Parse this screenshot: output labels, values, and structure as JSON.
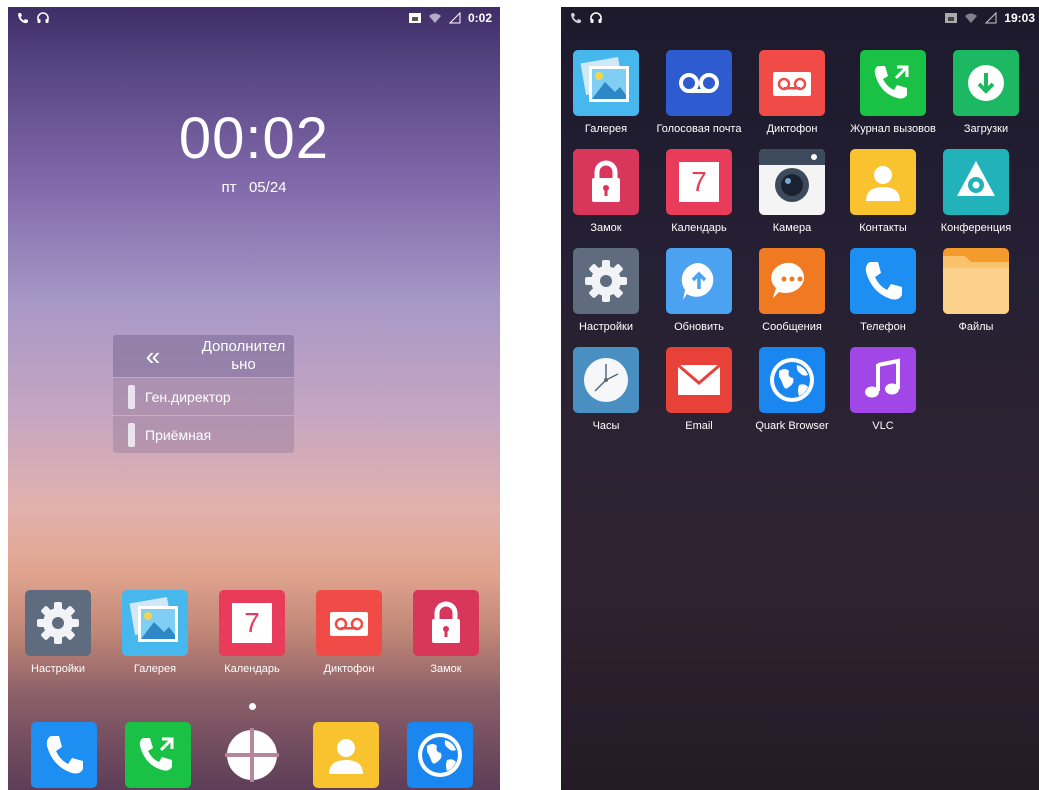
{
  "left_screen": {
    "status_bar": {
      "time": "0:02",
      "icons_left": [
        "phone-icon",
        "headset-icon"
      ],
      "icons_right": [
        "sim-icon",
        "wifi-icon",
        "signal-icon"
      ]
    },
    "lock_clock": {
      "time": "00:02",
      "date": "пт   05/24"
    },
    "contact_menu": {
      "header_label": "Дополнительно",
      "header_line1": "Дополнител",
      "header_line2": "ьно",
      "items": [
        {
          "label": "Ген.директор"
        },
        {
          "label": "Приёмная"
        }
      ]
    },
    "home_apps": [
      {
        "label": "Настройки",
        "icon": "settings-icon"
      },
      {
        "label": "Галерея",
        "icon": "gallery-icon"
      },
      {
        "label": "Календарь",
        "icon": "calendar-icon",
        "number": "7"
      },
      {
        "label": "Диктофон",
        "icon": "recorder-icon"
      },
      {
        "label": "Замок",
        "icon": "lock-icon"
      }
    ],
    "dock": [
      {
        "icon": "phone-icon"
      },
      {
        "icon": "call-log-icon"
      },
      {
        "icon": "app-drawer-icon"
      },
      {
        "icon": "contacts-icon"
      },
      {
        "icon": "browser-icon"
      }
    ]
  },
  "right_screen": {
    "status_bar": {
      "time": "19:03",
      "icons_left": [
        "phone-icon",
        "headset-icon"
      ],
      "icons_right": [
        "sim-icon",
        "wifi-icon",
        "signal-icon"
      ]
    },
    "apps": [
      {
        "label": "Галерея",
        "icon": "gallery-icon"
      },
      {
        "label": "Голосовая почта",
        "icon": "voicemail-icon"
      },
      {
        "label": "Диктофон",
        "icon": "recorder-icon"
      },
      {
        "label": "Журнал вызовов",
        "icon": "call-log-icon"
      },
      {
        "label": "Загрузки",
        "icon": "download-icon"
      },
      {
        "label": "Замок",
        "icon": "lock-icon"
      },
      {
        "label": "Календарь",
        "icon": "calendar-icon",
        "number": "7"
      },
      {
        "label": "Камера",
        "icon": "camera-icon"
      },
      {
        "label": "Контакты",
        "icon": "contacts-icon"
      },
      {
        "label": "Конференция",
        "icon": "conference-icon"
      },
      {
        "label": "Настройки",
        "icon": "settings-icon"
      },
      {
        "label": "Обновить",
        "icon": "update-icon"
      },
      {
        "label": "Сообщения",
        "icon": "messages-icon"
      },
      {
        "label": "Телефон",
        "icon": "phone-icon"
      },
      {
        "label": "Файлы",
        "icon": "files-icon"
      },
      {
        "label": "Часы",
        "icon": "clock-icon"
      },
      {
        "label": "Email",
        "icon": "email-icon"
      },
      {
        "label": "Quark Browser",
        "icon": "browser-icon"
      },
      {
        "label": "VLC",
        "icon": "vlc-icon"
      }
    ]
  },
  "colors": {
    "settings": "#5f6b7f",
    "gallery": "#46b8ee",
    "calendar": "#e83c5a",
    "recorder": "#f04b47",
    "lock": "#d8365a",
    "phone": "#1e8ff2",
    "call_log": "#19c145",
    "contacts": "#f9c22f",
    "browser": "#1a86f0",
    "voicemail": "#2f5bd0",
    "download": "#1db862",
    "camera": "#f4f4f4",
    "conference": "#21b3b9",
    "update": "#4aa2f0",
    "messages": "#f07a22",
    "files": "#f59a2c",
    "clock": "#4a8fc2",
    "email": "#e8413a",
    "vlc": "#a147e8"
  }
}
